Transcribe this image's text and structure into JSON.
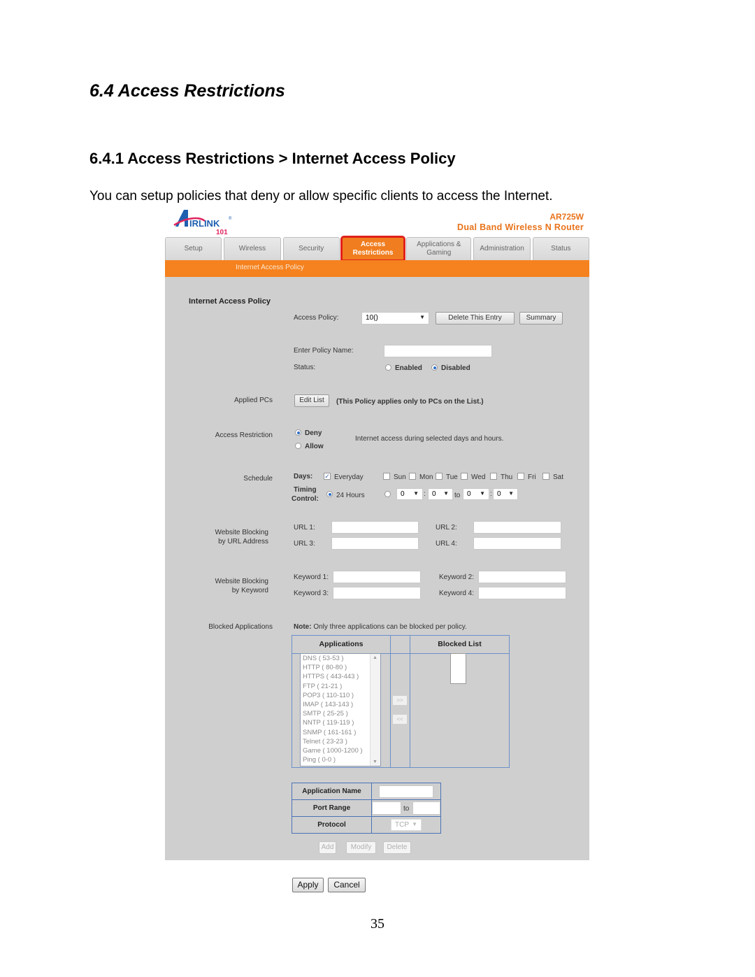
{
  "doc": {
    "section_title": "6.4 Access Restrictions",
    "subsection_title": "6.4.1 Access Restrictions > Internet Access Policy",
    "intro": "You can setup policies that deny or allow specific clients to access the Internet.",
    "page_number": "35"
  },
  "router": {
    "logo_text": "AIRLINK 101",
    "model": "AR725W",
    "description": "Dual Band Wireless N Router",
    "accent_color": "#f5821f",
    "tabs": [
      {
        "label": "Setup",
        "active": false
      },
      {
        "label": "Wireless",
        "active": false
      },
      {
        "label": "Security",
        "active": false
      },
      {
        "label": "Access Restrictions",
        "active": true
      },
      {
        "label": "Applications & Gaming",
        "active": false
      },
      {
        "label": "Administration",
        "active": false
      },
      {
        "label": "Status",
        "active": false
      }
    ],
    "subnav": "Internet Access Policy"
  },
  "form": {
    "section_title": "Internet Access Policy",
    "access_policy": {
      "label": "Access Policy:",
      "value": "10()",
      "delete_label": "Delete This Entry",
      "summary_label": "Summary"
    },
    "policy_name": {
      "label": "Enter Policy Name:",
      "value": ""
    },
    "status": {
      "label": "Status:",
      "options": [
        "Enabled",
        "Disabled"
      ],
      "selected": "Disabled"
    },
    "applied_pcs": {
      "label": "Applied PCs",
      "button": "Edit List",
      "note": "(This Policy applies only to PCs on the List.)"
    },
    "access_restriction": {
      "label": "Access Restriction",
      "options": [
        "Deny",
        "Allow"
      ],
      "selected": "Deny",
      "description": "Internet access during selected days and hours."
    },
    "schedule": {
      "label": "Schedule",
      "days_label": "Days:",
      "everyday_label": "Everyday",
      "everyday_checked": true,
      "days": [
        "Sun",
        "Mon",
        "Tue",
        "Wed",
        "Thu",
        "Fri",
        "Sat"
      ],
      "timing_label_1": "Timing",
      "timing_label_2": "Control:",
      "hours24_label": "24 Hours",
      "hours24_selected": true,
      "from_hour": "0",
      "from_min": "0",
      "to_label": "to",
      "to_hour": "0",
      "to_min": "0"
    },
    "url_blocking": {
      "label_1": "Website Blocking",
      "label_2": "by URL Address",
      "fields": [
        {
          "label": "URL 1:",
          "value": ""
        },
        {
          "label": "URL 2:",
          "value": ""
        },
        {
          "label": "URL 3:",
          "value": ""
        },
        {
          "label": "URL 4:",
          "value": ""
        }
      ]
    },
    "keyword_blocking": {
      "label_1": "Website Blocking",
      "label_2": "by Keyword",
      "fields": [
        {
          "label": "Keyword 1:",
          "value": ""
        },
        {
          "label": "Keyword 2:",
          "value": ""
        },
        {
          "label": "Keyword 3:",
          "value": ""
        },
        {
          "label": "Keyword 4:",
          "value": ""
        }
      ]
    },
    "blocked_apps": {
      "label": "Blocked Applications",
      "note_bold": "Note:",
      "note": "Only three applications can be blocked per policy.",
      "applications_header": "Applications",
      "blocked_header": "Blocked List",
      "applications": [
        "DNS ( 53-53 )",
        "HTTP ( 80-80 )",
        "HTTPS ( 443-443 )",
        "FTP ( 21-21 )",
        "POP3 ( 110-110 )",
        "IMAP ( 143-143 )",
        "SMTP ( 25-25 )",
        "NNTP ( 119-119 )",
        "SNMP ( 161-161 )",
        "Telnet ( 23-23 )",
        "Game ( 1000-1200 )",
        "Ping ( 0-0 )"
      ],
      "add_arrow": ">>",
      "remove_arrow": "<<"
    },
    "custom_app": {
      "name_label": "Application Name",
      "name_value": "",
      "port_label": "Port Range",
      "port_from": "",
      "port_to_label": "to",
      "port_to": "",
      "protocol_label": "Protocol",
      "protocol_value": "TCP",
      "add_label": "Add",
      "modify_label": "Modify",
      "delete_label": "Delete"
    },
    "apply_label": "Apply",
    "cancel_label": "Cancel"
  }
}
